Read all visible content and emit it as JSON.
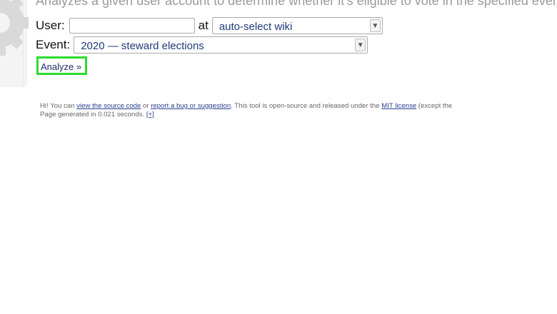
{
  "intro": "Analyzes a given user account to determine whether it's eligible to vote in the specified event.",
  "form": {
    "user_label": "User:",
    "user_value": "",
    "at_label": "at",
    "wiki_selected": "auto-select wiki",
    "event_label": "Event:",
    "event_selected": "2020 — steward elections",
    "analyze_label": "Analyze »"
  },
  "footer": {
    "line1_prefix": "Hi! You can ",
    "source_link": "view the source code",
    "or": " or ",
    "bug_link": "report a bug or suggestion",
    "line1_mid": ". This tool is open-source and released under the ",
    "license_link": "MIT license",
    "line1_suffix": " (except the",
    "line2_prefix": "Page generated in 0.021 seconds. ",
    "expand_link": "[+]"
  },
  "colors": {
    "highlight": "#2ddc2d",
    "link": "#2a3f8f"
  },
  "icons": {
    "gear": "gear-icon",
    "dropdown": "chevron-down-icon"
  }
}
